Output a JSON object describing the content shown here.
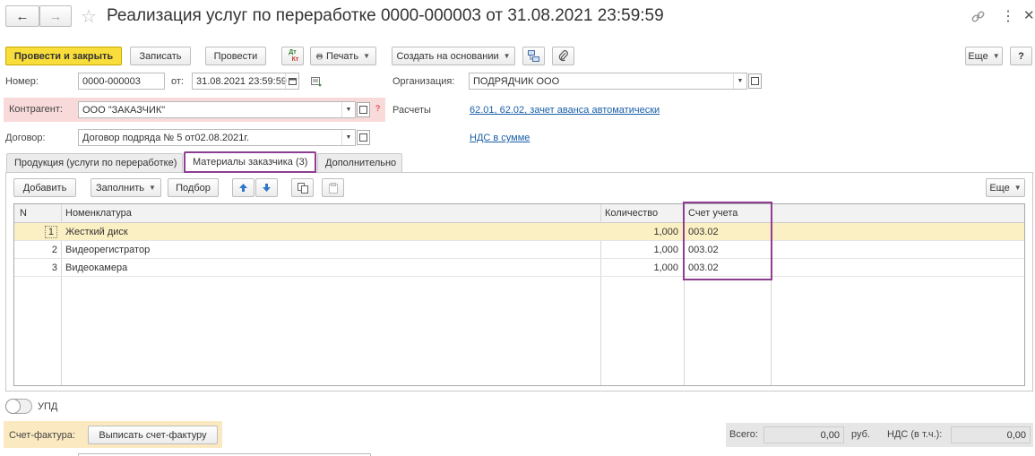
{
  "header": {
    "title": "Реализация услуг по переработке 0000-000003 от 31.08.2021 23:59:59",
    "back_glyph": "←",
    "forward_glyph": "→",
    "star_glyph": "☆",
    "link_glyph": "🔗",
    "more_glyph": "⋮",
    "close_glyph": "✕"
  },
  "toolbar": {
    "post_close": "Провести и закрыть",
    "save": "Записать",
    "post": "Провести",
    "print": "Печать",
    "create_based": "Создать на основании",
    "more": "Еще",
    "help": "?",
    "dtkt_top": "Дт",
    "dtkt_bottom": "Кт"
  },
  "form": {
    "number_label": "Номер:",
    "number_value": "0000-000003",
    "from_label": "от:",
    "date_value": "31.08.2021 23:59:59",
    "org_label": "Организация:",
    "org_value": "ПОДРЯДЧИК ООО",
    "counterparty_label": "Контрагент:",
    "counterparty_value": "ООО \"ЗАКАЗЧИК\"",
    "counterparty_help": "?",
    "settlements_label": "Расчеты",
    "settlements_link": "62.01, 62.02, зачет аванса автоматически",
    "contract_label": "Договор:",
    "contract_value": "Договор подряда № 5 от02.08.2021г.",
    "vat_link": "НДС в сумме"
  },
  "tabs": [
    {
      "label": "Продукция (услуги по переработке)"
    },
    {
      "label": "Материалы заказчика (3)"
    },
    {
      "label": "Дополнительно"
    }
  ],
  "table_toolbar": {
    "add": "Добавить",
    "fill": "Заполнить",
    "pick": "Подбор",
    "more": "Еще"
  },
  "table": {
    "columns": [
      "N",
      "Номенклатура",
      "Количество",
      "Счет учета"
    ],
    "rows": [
      {
        "n": "1",
        "name": "Жесткий диск",
        "qty": "1,000",
        "account": "003.02"
      },
      {
        "n": "2",
        "name": "Видеорегистратор",
        "qty": "1,000",
        "account": "003.02"
      },
      {
        "n": "3",
        "name": "Видеокамера",
        "qty": "1,000",
        "account": "003.02"
      }
    ]
  },
  "footer": {
    "upd_label": "УПД",
    "invoice_label": "Счет-фактура:",
    "invoice_button": "Выписать счет-фактуру",
    "total_label": "Всего:",
    "total_value": "0,00",
    "currency": "руб.",
    "vat_label": "НДС (в т.ч.):",
    "vat_value": "0,00"
  },
  "colors": {
    "accent_yellow": "#f9dd3b",
    "highlight_purple": "#8c3e91",
    "error_pink": "#f9dadb",
    "link_blue": "#1a5fa8",
    "selected_row": "#fbf0c3"
  }
}
